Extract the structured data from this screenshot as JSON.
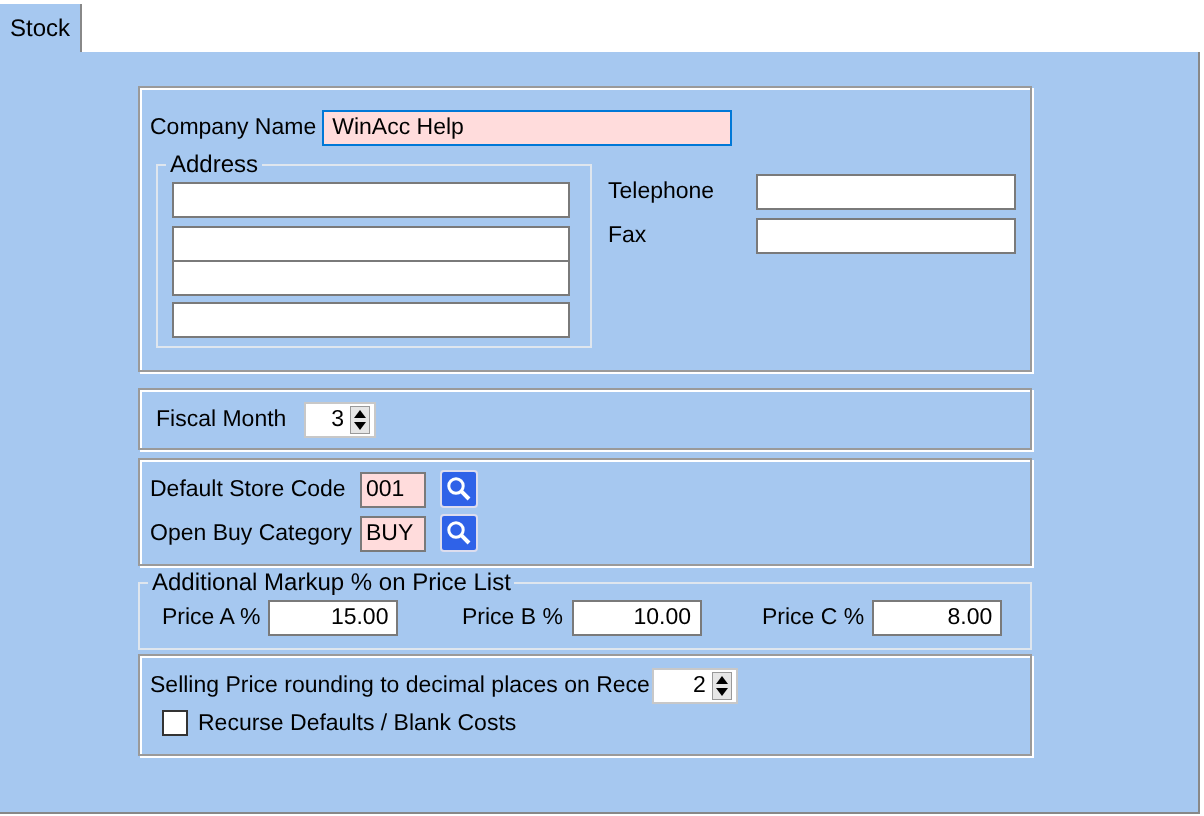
{
  "tab": {
    "label": "Stock",
    "selected": true
  },
  "company": {
    "label": "Company Name",
    "value": "WinAcc Help"
  },
  "address": {
    "legend": "Address"
  },
  "telephone": {
    "label": "Telephone"
  },
  "fax": {
    "label": "Fax"
  },
  "fiscal_month": {
    "label": "Fiscal Month",
    "value": "3"
  },
  "lookups": [
    {
      "label": "Default Store Code",
      "value": "001"
    },
    {
      "label": "Open Buy Category",
      "value": "BUY"
    }
  ],
  "markup": {
    "legend": "Additional Markup % on Price List",
    "prices": [
      {
        "label": "Price A %",
        "value": "15.00"
      },
      {
        "label": "Price B %",
        "value": "10.00"
      },
      {
        "label": "Price C %",
        "value": "8.00"
      }
    ]
  },
  "rounding": {
    "label": "Selling Price rounding to decimal places on Rece",
    "value": "2"
  },
  "recurse": {
    "label": "Recurse Defaults / Blank Costs",
    "checked": false
  }
}
